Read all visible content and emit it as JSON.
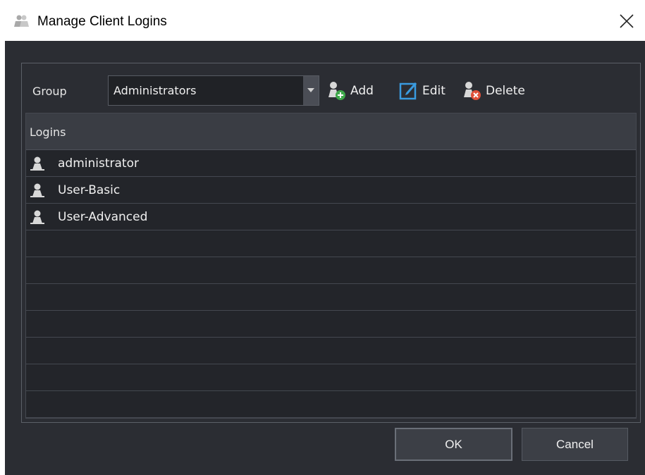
{
  "window": {
    "title": "Manage Client Logins",
    "close_icon": "close-icon",
    "title_icon": "users-icon"
  },
  "group": {
    "label": "Group",
    "selected": "Administrators"
  },
  "toolbar": {
    "add_label": "Add",
    "edit_label": "Edit",
    "delete_label": "Delete"
  },
  "logins": {
    "header": "Logins",
    "items": [
      {
        "name": "administrator"
      },
      {
        "name": "User-Basic"
      },
      {
        "name": "User-Advanced"
      }
    ]
  },
  "footer": {
    "ok_label": "OK",
    "cancel_label": "Cancel"
  },
  "colors": {
    "add_accent": "#3ea84a",
    "edit_accent": "#3a9be0",
    "delete_accent": "#e0503a"
  }
}
